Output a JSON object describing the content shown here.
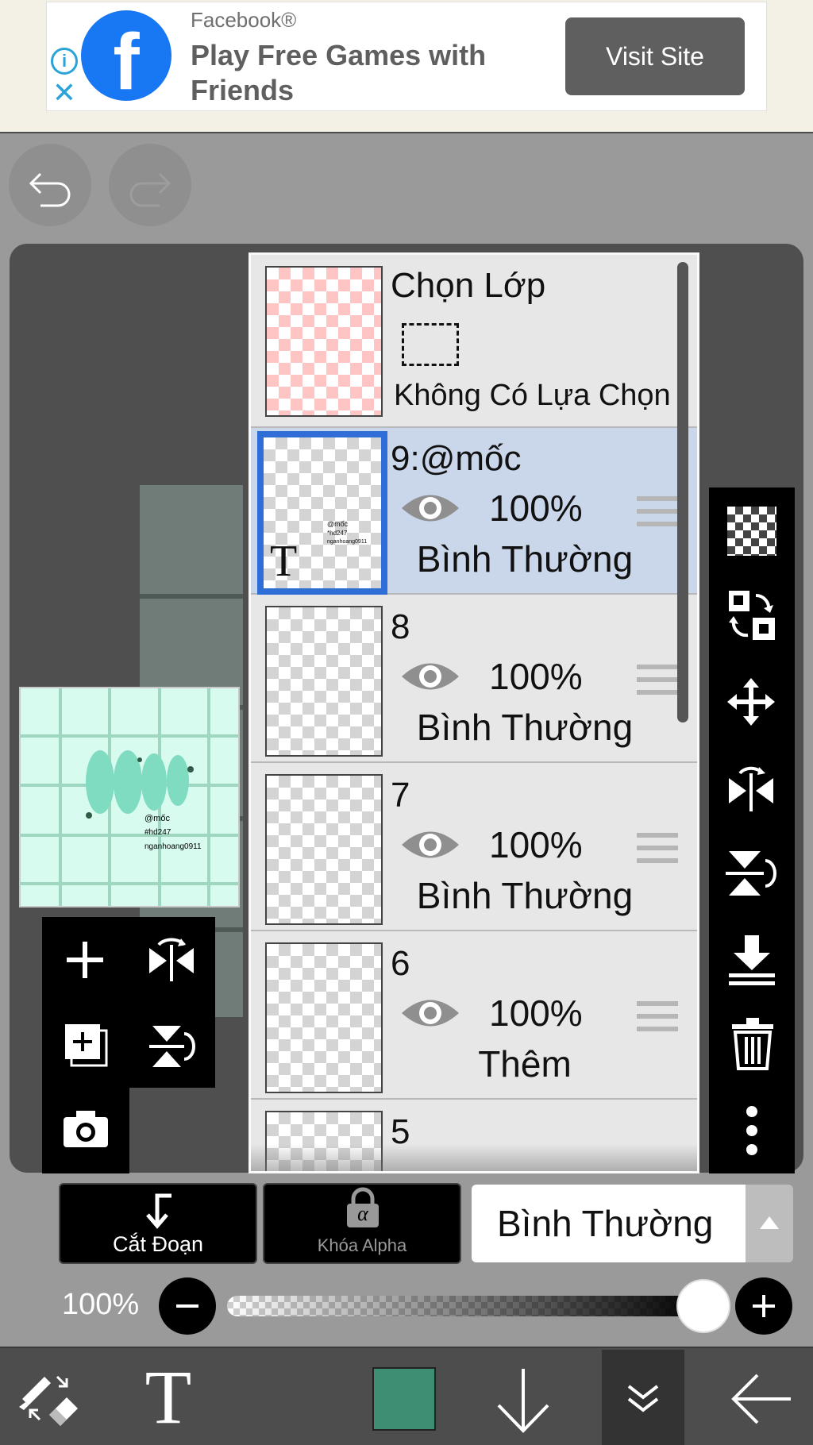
{
  "ad": {
    "brand": "Facebook®",
    "headline": "Play Free Games with Friends",
    "cta": "Visit Site",
    "info_icon": "info-icon",
    "close_icon": "close-icon"
  },
  "selection_layer": {
    "title": "Chọn Lớp",
    "status": "Không Có Lựa Chọn"
  },
  "layers": [
    {
      "name": "9:@mốc",
      "opacity": "100%",
      "blend": "Bình Thường",
      "selected": true,
      "type": "text"
    },
    {
      "name": "8",
      "opacity": "100%",
      "blend": "Bình Thường"
    },
    {
      "name": "7",
      "opacity": "100%",
      "blend": "Bình Thường"
    },
    {
      "name": "6",
      "opacity": "100%",
      "blend": "Thêm"
    },
    {
      "name": "5"
    }
  ],
  "text_thumb": {
    "letter": "T",
    "line1": "@mốc",
    "line2": "*hd247",
    "line3": "nganhoang0911"
  },
  "preview": {
    "line1": "@mốc",
    "line2": "#hd247",
    "line3": "nganhoang0911"
  },
  "blend_controls": {
    "clipping_label": "Cắt Đoạn",
    "alpha_lock_label": "Khóa Alpha",
    "alpha_symbol": "α",
    "blend_mode": "Bình Thường"
  },
  "opacity": {
    "label": "100%",
    "value": 1.0
  },
  "colors": {
    "current_color": "#3e8e73",
    "selection_highlight": "#2f6ed6"
  },
  "bottom_bar": {
    "text_tool_label": "T"
  }
}
